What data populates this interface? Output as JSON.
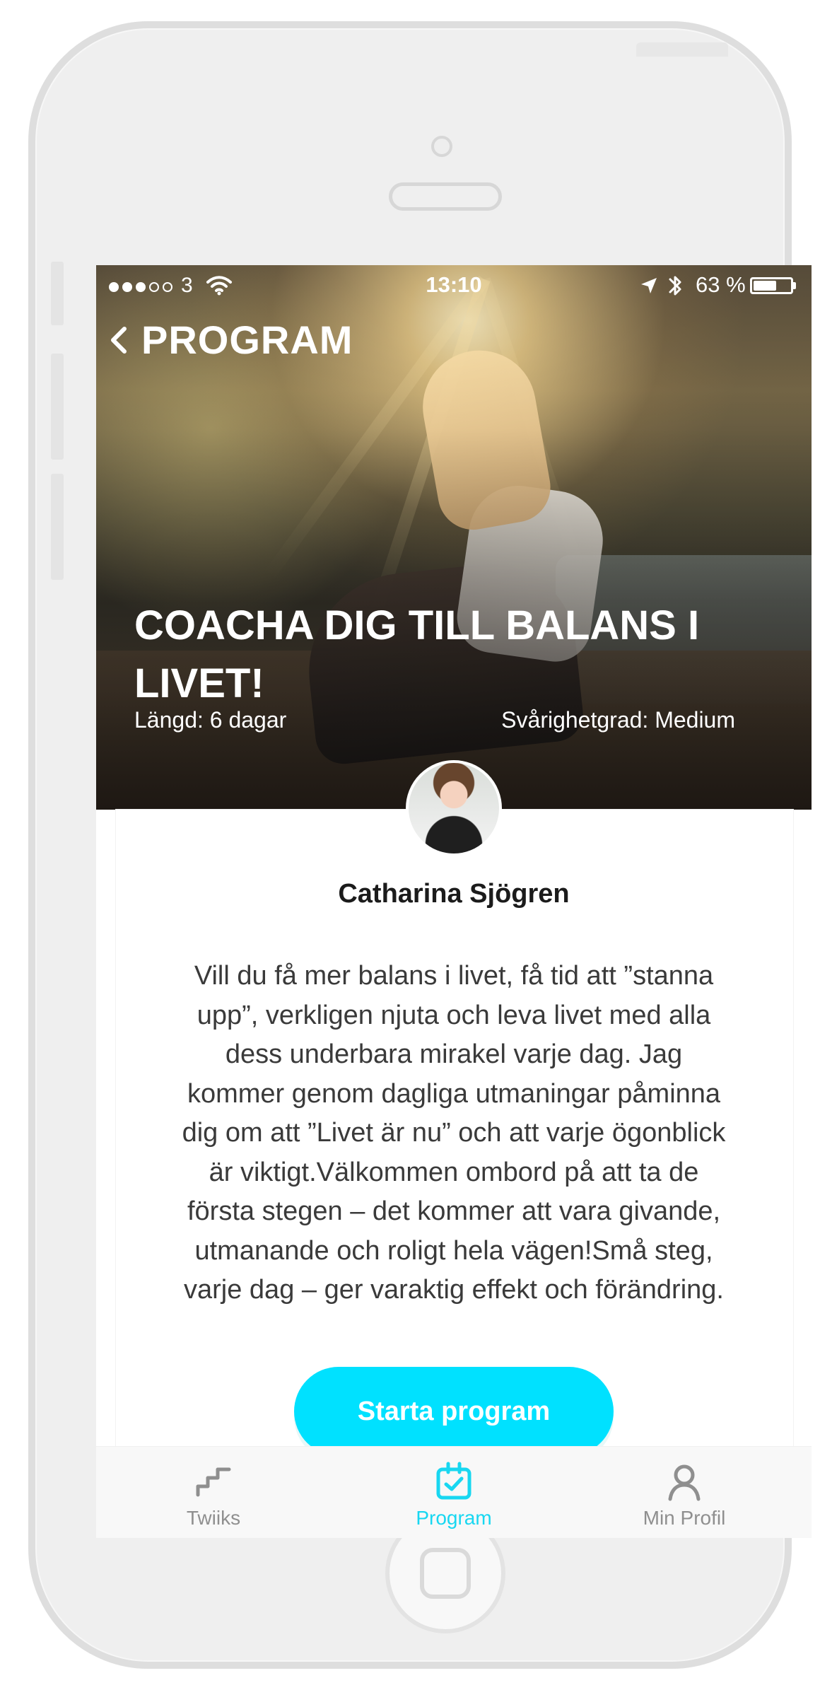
{
  "status": {
    "carrier": "3",
    "time": "13:10",
    "battery": "63 %",
    "battery_level_percent": 63
  },
  "nav": {
    "title": "PROGRAM",
    "back_icon": "chevron-left-icon"
  },
  "hero": {
    "title": "COACHA DIG TILL BALANS I LIVET!",
    "length": "Längd: 6 dagar",
    "difficulty": "Svårighetgrad: Medium"
  },
  "coach": {
    "name": "Catharina Sjögren"
  },
  "description": "Vill du få mer balans i livet, få tid att ”stanna upp”, verkligen njuta och leva livet med alla dess underbara mirakel varje dag. Jag kommer genom dagliga utmaningar påminna dig om att ”Livet är nu” och att varje ögonblick är viktigt.Välkommen ombord på att ta de första stegen – det kommer att vara givande, utmanande och roligt hela vägen!Små steg, varje dag – ger varaktig effekt och förändring.",
  "actions": {
    "start_label": "Starta program"
  },
  "tabs": [
    {
      "label": "Twiiks",
      "icon": "stairs-icon",
      "active": false
    },
    {
      "label": "Program",
      "icon": "calendar-check-icon",
      "active": true
    },
    {
      "label": "Min Profil",
      "icon": "user-icon",
      "active": false
    }
  ],
  "colors": {
    "accent": "#00e1ff",
    "active_tab": "#18d7f1",
    "inactive_tab": "#8f8f8f"
  }
}
